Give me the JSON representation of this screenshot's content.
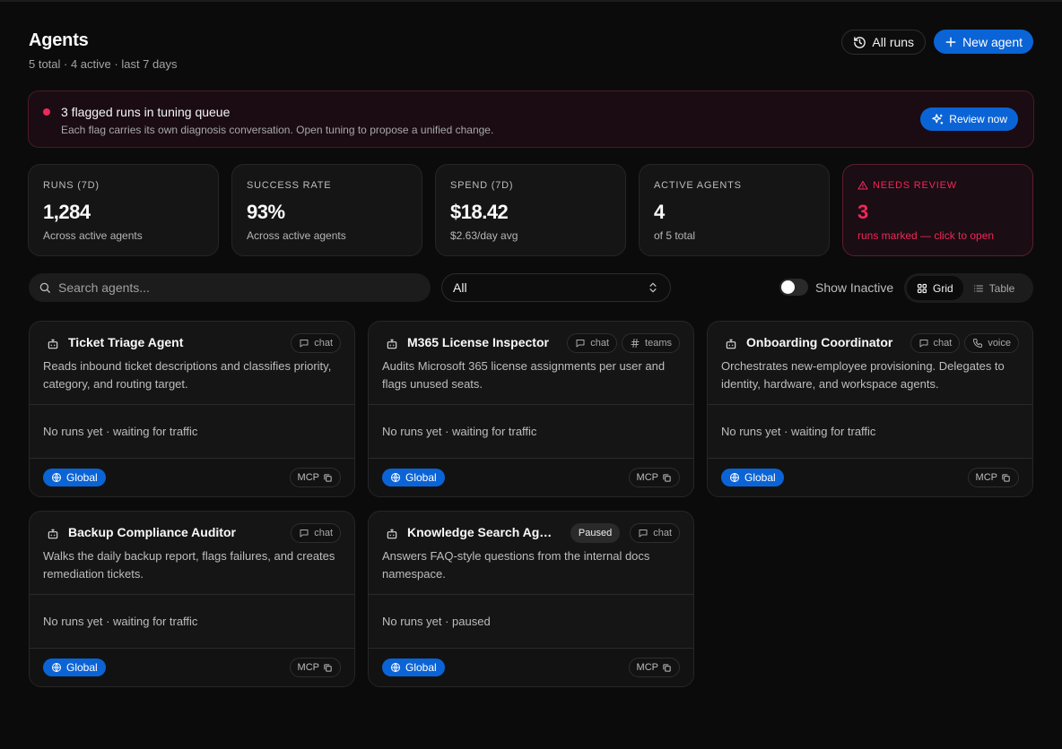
{
  "header": {
    "title": "Agents",
    "subtitle": "5 total · 4 active · last 7 days",
    "all_runs_label": "All runs",
    "new_agent_label": "New agent"
  },
  "alert": {
    "title": "3 flagged runs in tuning queue",
    "description": "Each flag carries its own diagnosis conversation. Open tuning to propose a unified change.",
    "button_label": "Review now"
  },
  "stats": [
    {
      "label": "RUNS (7D)",
      "value": "1,284",
      "sub": "Across active agents"
    },
    {
      "label": "SUCCESS RATE",
      "value": "93%",
      "sub": "Across active agents"
    },
    {
      "label": "SPEND (7D)",
      "value": "$18.42",
      "sub": "$2.63/day avg"
    },
    {
      "label": "ACTIVE AGENTS",
      "value": "4",
      "sub": "of 5 total"
    },
    {
      "label": "NEEDS REVIEW",
      "value": "3",
      "sub": "runs marked — click to open"
    }
  ],
  "toolbar": {
    "search_placeholder": "Search agents...",
    "filter_value": "All",
    "show_inactive_label": "Show Inactive",
    "show_inactive_on": false,
    "grid_label": "Grid",
    "table_label": "Table",
    "active_view": "Grid"
  },
  "cards": [
    {
      "title": "Ticket Triage Agent",
      "description": "Reads inbound ticket descriptions and classifies priority, category, and routing target.",
      "status": "No runs yet · waiting for traffic",
      "scope": "Global",
      "mcp_label": "MCP",
      "chips": [
        {
          "label": "chat",
          "icon": "chat-icon"
        }
      ]
    },
    {
      "title": "M365 License Inspector",
      "description": "Audits Microsoft 365 license assignments per user and flags unused seats.",
      "status": "No runs yet · waiting for traffic",
      "scope": "Global",
      "mcp_label": "MCP",
      "chips": [
        {
          "label": "chat",
          "icon": "chat-icon"
        },
        {
          "label": "teams",
          "icon": "hash-icon"
        }
      ]
    },
    {
      "title": "Onboarding Coordinator",
      "description": "Orchestrates new-employee provisioning. Delegates to identity, hardware, and workspace agents.",
      "status": "No runs yet · waiting for traffic",
      "scope": "Global",
      "mcp_label": "MCP",
      "chips": [
        {
          "label": "chat",
          "icon": "chat-icon"
        },
        {
          "label": "voice",
          "icon": "phone-icon"
        }
      ]
    },
    {
      "title": "Backup Compliance Auditor",
      "description": "Walks the daily backup report, flags failures, and creates remediation tickets.",
      "status": "No runs yet · waiting for traffic",
      "scope": "Global",
      "mcp_label": "MCP",
      "chips": [
        {
          "label": "chat",
          "icon": "chat-icon"
        }
      ]
    },
    {
      "title": "Knowledge Search Ag…",
      "badge": "Paused",
      "description": "Answers FAQ-style questions from the internal docs namespace.",
      "status": "No runs yet · paused",
      "scope": "Global",
      "mcp_label": "MCP",
      "chips": [
        {
          "label": "chat",
          "icon": "chat-icon"
        }
      ]
    }
  ],
  "colors": {
    "accent": "#0b64d6",
    "alert": "#f0285a",
    "background": "#0b0b0b",
    "card": "#151515"
  }
}
